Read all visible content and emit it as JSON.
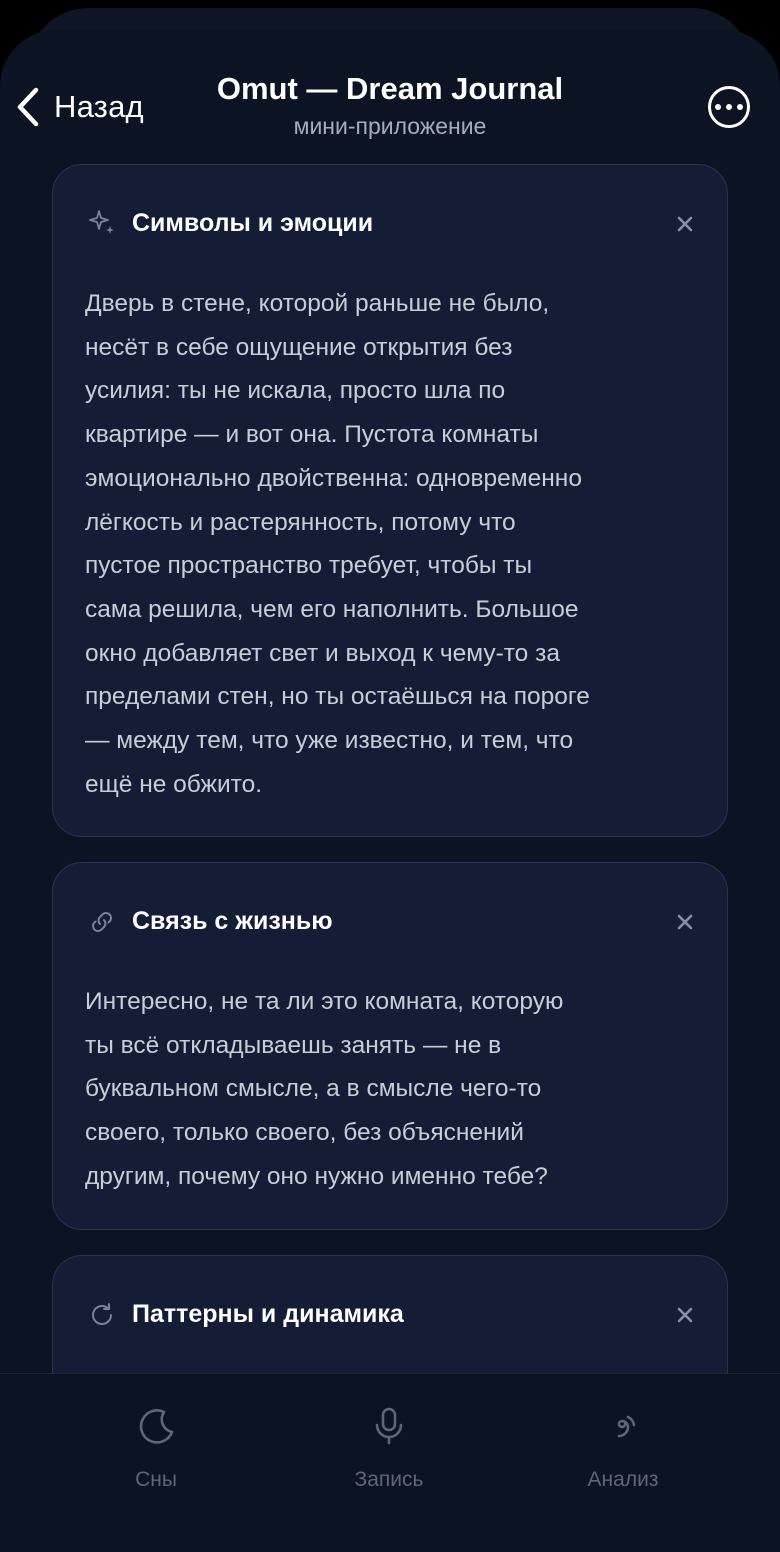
{
  "header": {
    "back_label": "Назад",
    "title": "Omut — Dream Journal",
    "subtitle": "мини-приложение"
  },
  "cards": [
    {
      "icon": "sparkle-icon",
      "title": "Символы и эмоции",
      "lines": [
        "Дверь в стене, которой раньше не было,",
        "несёт в себе ощущение открытия без",
        "усилия: ты не искала, просто шла по",
        "квартире — и вот она. Пустота комнаты",
        "эмоционально двойственна: одновременно",
        "лёгкость и растерянность, потому что",
        "пустое пространство требует, чтобы ты",
        "сама решила, чем его наполнить. Большое",
        "окно добавляет свет и выход к чему-то за",
        "пределами стен, но ты остаёшься на пороге",
        "— между тем, что уже известно, и тем, что",
        "ещё не обжито."
      ]
    },
    {
      "icon": "link-icon",
      "title": "Связь с жизнью",
      "lines": [
        "Интересно, не та ли это комната, которую",
        "ты всё откладываешь занять — не в",
        "буквальном смысле, а в смысле чего-то",
        "своего, только своего, без объяснений",
        "другим, почему оно нужно именно тебе?"
      ]
    },
    {
      "icon": "refresh-icon",
      "title": "Паттерны и динамика",
      "lines": []
    }
  ],
  "tabbar": {
    "tabs": [
      {
        "label": "Сны",
        "icon": "moon-icon"
      },
      {
        "label": "Запись",
        "icon": "microphone-icon"
      },
      {
        "label": "Анализ",
        "icon": "spiral-icon"
      }
    ]
  },
  "colors": {
    "background": "#0c1322",
    "card": "#151d36",
    "card_border": "#2a3350",
    "text_primary": "#ffffff",
    "text_body": "#c9cdd7",
    "text_muted": "#5f6678"
  }
}
